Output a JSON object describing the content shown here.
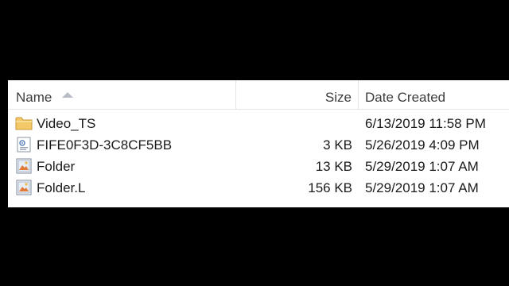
{
  "columns": {
    "name": "Name",
    "size": "Size",
    "date_created": "Date Created"
  },
  "files": [
    {
      "name": "Video_TS",
      "size": "",
      "date_created": "6/13/2019 11:58 PM",
      "icon": "folder-icon"
    },
    {
      "name": "FIFE0F3D-3C8CF5BB",
      "size": "3 KB",
      "date_created": "5/26/2019 4:09 PM",
      "icon": "settings-file-icon"
    },
    {
      "name": "Folder",
      "size": "13 KB",
      "date_created": "5/29/2019 1:07 AM",
      "icon": "image-file-icon"
    },
    {
      "name": "Folder.L",
      "size": "156 KB",
      "date_created": "5/29/2019 1:07 AM",
      "icon": "image-file-icon"
    }
  ],
  "colors": {
    "background": "#000000",
    "panel": "#ffffff",
    "folder": "#f2c868",
    "header_text": "#3c3c3c"
  }
}
